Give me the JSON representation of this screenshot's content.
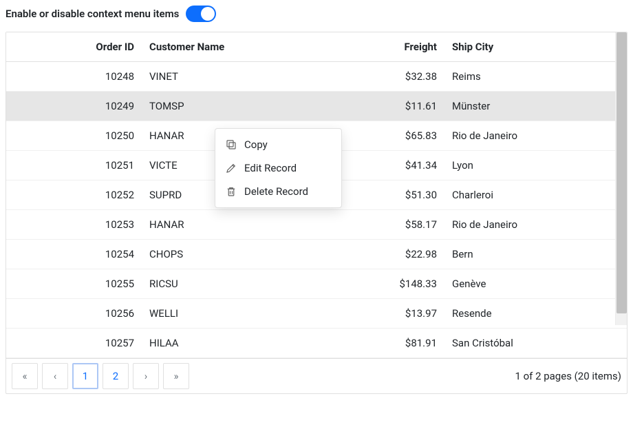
{
  "toggle_label": "Enable or disable context menu items",
  "columns": {
    "order_id": "Order ID",
    "customer_name": "Customer Name",
    "freight": "Freight",
    "ship_city": "Ship City"
  },
  "rows": [
    {
      "order_id": "10248",
      "customer": "VINET",
      "freight": "$32.38",
      "city": "Reims"
    },
    {
      "order_id": "10249",
      "customer": "TOMSP",
      "freight": "$11.61",
      "city": "Münster"
    },
    {
      "order_id": "10250",
      "customer": "HANAR",
      "freight": "$65.83",
      "city": "Rio de Janeiro"
    },
    {
      "order_id": "10251",
      "customer": "VICTE",
      "freight": "$41.34",
      "city": "Lyon"
    },
    {
      "order_id": "10252",
      "customer": "SUPRD",
      "freight": "$51.30",
      "city": "Charleroi"
    },
    {
      "order_id": "10253",
      "customer": "HANAR",
      "freight": "$58.17",
      "city": "Rio de Janeiro"
    },
    {
      "order_id": "10254",
      "customer": "CHOPS",
      "freight": "$22.98",
      "city": "Bern"
    },
    {
      "order_id": "10255",
      "customer": "RICSU",
      "freight": "$148.33",
      "city": "Genève"
    },
    {
      "order_id": "10256",
      "customer": "WELLI",
      "freight": "$13.97",
      "city": "Resende"
    },
    {
      "order_id": "10257",
      "customer": "HILAA",
      "freight": "$81.91",
      "city": "San Cristóbal"
    }
  ],
  "context_menu": {
    "copy": "Copy",
    "edit": "Edit Record",
    "delete": "Delete Record"
  },
  "pager": {
    "first": "«",
    "prev": "‹",
    "page1": "1",
    "page2": "2",
    "next": "›",
    "last": "»",
    "info": "1 of 2 pages (20 items)"
  }
}
